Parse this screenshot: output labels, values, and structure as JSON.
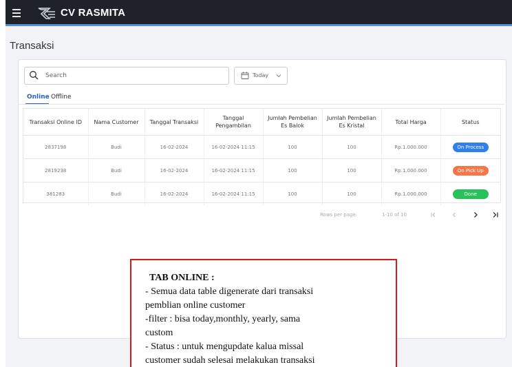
{
  "app": {
    "brand": "CV RASMITA"
  },
  "page": {
    "title": "Transaksi"
  },
  "search": {
    "placeholder": "Search"
  },
  "date_filter": {
    "value": "Today"
  },
  "tabs": [
    {
      "label": "Online"
    },
    {
      "label": "Offline"
    }
  ],
  "table": {
    "headers": [
      "Transaksi Online ID",
      "Nama Customer",
      "Tanggal Transaksi",
      "Tanggal Pengambilan",
      "Jumlah Pembelian Es Balok",
      "Jumlah Pembelian Es Kristal",
      "Total Harga",
      "Status"
    ],
    "rows": [
      {
        "id": "2837198",
        "customer": "Budi",
        "tgl_transaksi": "16-02-2024",
        "tgl_pengambilan": "16-02-2024 11:15",
        "es_balok": "100",
        "es_kristal": "100",
        "total": "Rp.1.000.000",
        "status": "On Process",
        "status_color": "#2f80ed"
      },
      {
        "id": "2819238",
        "customer": "Budi",
        "tgl_transaksi": "16-02-2024",
        "tgl_pengambilan": "16-02-2024 11:15",
        "es_balok": "100",
        "es_kristal": "100",
        "total": "Rp.1.000.000",
        "status": "On Pick Up",
        "status_color": "#f2774a"
      },
      {
        "id": "381283",
        "customer": "Budi",
        "tgl_transaksi": "16-02-2024",
        "tgl_pengambilan": "16-02-2024 11:15",
        "es_balok": "100",
        "es_kristal": "100",
        "total": "Rp.1.000.000",
        "status": "Done",
        "status_color": "#27c25a"
      }
    ]
  },
  "pagination": {
    "rows_per_page_label": "Rows per page:",
    "range": "1-10 of 10"
  },
  "note": {
    "title": "TAB ONLINE :",
    "lines": [
      "- Semua data table digenerate dari transaksi",
      "pemblian online customer",
      "-filter : bisa today,monthly, yearly, sama",
      "custom",
      "- Status : untuk mengupdate kalua missal",
      "customer sudah selesai melakukan transaksi"
    ]
  },
  "colors": {
    "topbar": "#1f2329",
    "accent": "#2563c4",
    "note_border": "#d9161b"
  }
}
